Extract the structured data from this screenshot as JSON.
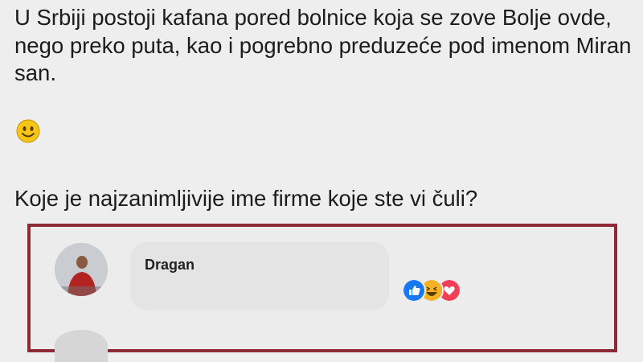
{
  "post": {
    "text": "U Srbiji postoji kafana pored bolnice koja se zove Bolje ovde, nego preko puta, kao i pogrebno preduzeće pod imenom Miran san.",
    "question": "Koje je najzanimljivije ime firme koje ste vi čuli?",
    "emoji_icon": "smiley-face-icon"
  },
  "comment": {
    "author": "Dragan",
    "reactions": [
      "like-icon",
      "haha-icon",
      "love-icon"
    ],
    "frame_color": "#8e2a36"
  },
  "colors": {
    "like": "#1877f2",
    "haha": "#f7b125",
    "love": "#f33e58"
  }
}
